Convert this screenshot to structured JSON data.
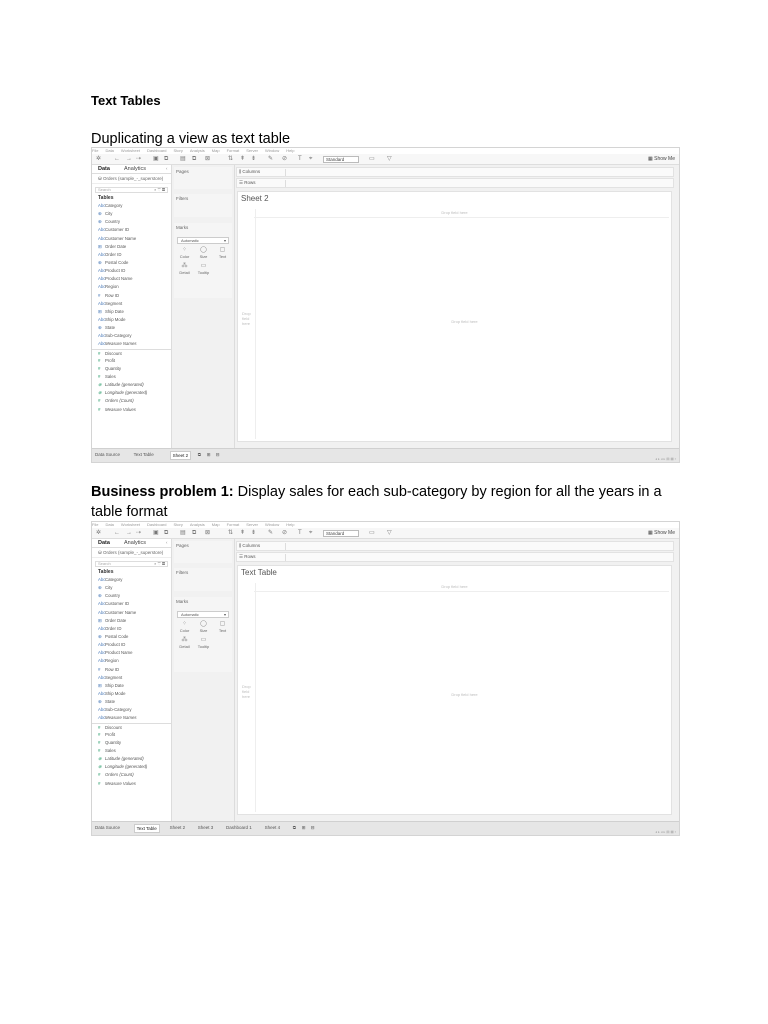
{
  "heading": "Text Tables",
  "para1": "Duplicating a view as text table",
  "para2_bold": "Business problem 1:",
  "para2_rest": " Display sales for each sub-category by region for all the years in a table format",
  "tableau": {
    "menu": [
      "File",
      "Data",
      "Worksheet",
      "Dashboard",
      "Story",
      "Analysis",
      "Map",
      "Format",
      "Server",
      "Window",
      "Help"
    ],
    "toolbar_standard": "Standard",
    "show_me": "Show Me",
    "tab_data": "Data",
    "tab_analytics": "Analytics",
    "datasource": "Orders (sample_-_superstore)",
    "search_placeholder": "Search",
    "tables_heading": "Tables",
    "dimensions": [
      {
        "t": "Abc",
        "n": "Category"
      },
      {
        "t": "⊕",
        "n": "City"
      },
      {
        "t": "⊕",
        "n": "Country"
      },
      {
        "t": "Abc",
        "n": "Customer ID"
      },
      {
        "t": "Abc",
        "n": "Customer Name"
      },
      {
        "t": "⊞",
        "n": "Order Date"
      },
      {
        "t": "Abc",
        "n": "Order ID"
      },
      {
        "t": "⊕",
        "n": "Postal Code"
      },
      {
        "t": "Abc",
        "n": "Product ID"
      },
      {
        "t": "Abc",
        "n": "Product Name"
      },
      {
        "t": "Abc",
        "n": "Region"
      },
      {
        "t": "#",
        "n": "Row ID"
      },
      {
        "t": "Abc",
        "n": "Segment"
      },
      {
        "t": "⊞",
        "n": "Ship Date"
      },
      {
        "t": "Abc",
        "n": "Ship Mode"
      },
      {
        "t": "⊕",
        "n": "State"
      },
      {
        "t": "Abc",
        "n": "Sub-Category"
      },
      {
        "t": "Abc",
        "n": "Measure Names",
        "it": true
      }
    ],
    "measures": [
      {
        "t": "#",
        "n": "Discount"
      },
      {
        "t": "#",
        "n": "Profit"
      },
      {
        "t": "#",
        "n": "Quantity"
      },
      {
        "t": "#",
        "n": "Sales"
      },
      {
        "t": "⊕",
        "n": "Latitude (generated)",
        "it": true
      },
      {
        "t": "⊕",
        "n": "Longitude (generated)",
        "it": true
      },
      {
        "t": "#",
        "n": "Orders (Count)",
        "it": true
      },
      {
        "t": "#",
        "n": "Measure Values",
        "it": true
      }
    ],
    "pages_label": "Pages",
    "filters_label": "Filters",
    "marks_label": "Marks",
    "marks_type": "Automatic",
    "mark_buttons": [
      "Color",
      "Size",
      "Text",
      "Detail",
      "Tooltip"
    ],
    "columns_label": "Columns",
    "rows_label": "Rows",
    "drop_field_here": "Drop field here",
    "drop_side": "Drop field here"
  },
  "shot1": {
    "sheet_title": "Sheet 2",
    "tabs": [
      {
        "label": "Data Source",
        "active": false
      },
      {
        "label": "Text Table",
        "active": false
      },
      {
        "label": "Sheet 2",
        "active": true
      }
    ]
  },
  "shot2": {
    "sheet_title": "Text Table",
    "tabs": [
      {
        "label": "Data Source",
        "active": false
      },
      {
        "label": "Text Table",
        "active": true
      },
      {
        "label": "Sheet 2",
        "active": false
      },
      {
        "label": "Sheet 3",
        "active": false
      },
      {
        "label": "Dashboard 1",
        "active": false
      },
      {
        "label": "Sheet 4",
        "active": false
      }
    ]
  }
}
